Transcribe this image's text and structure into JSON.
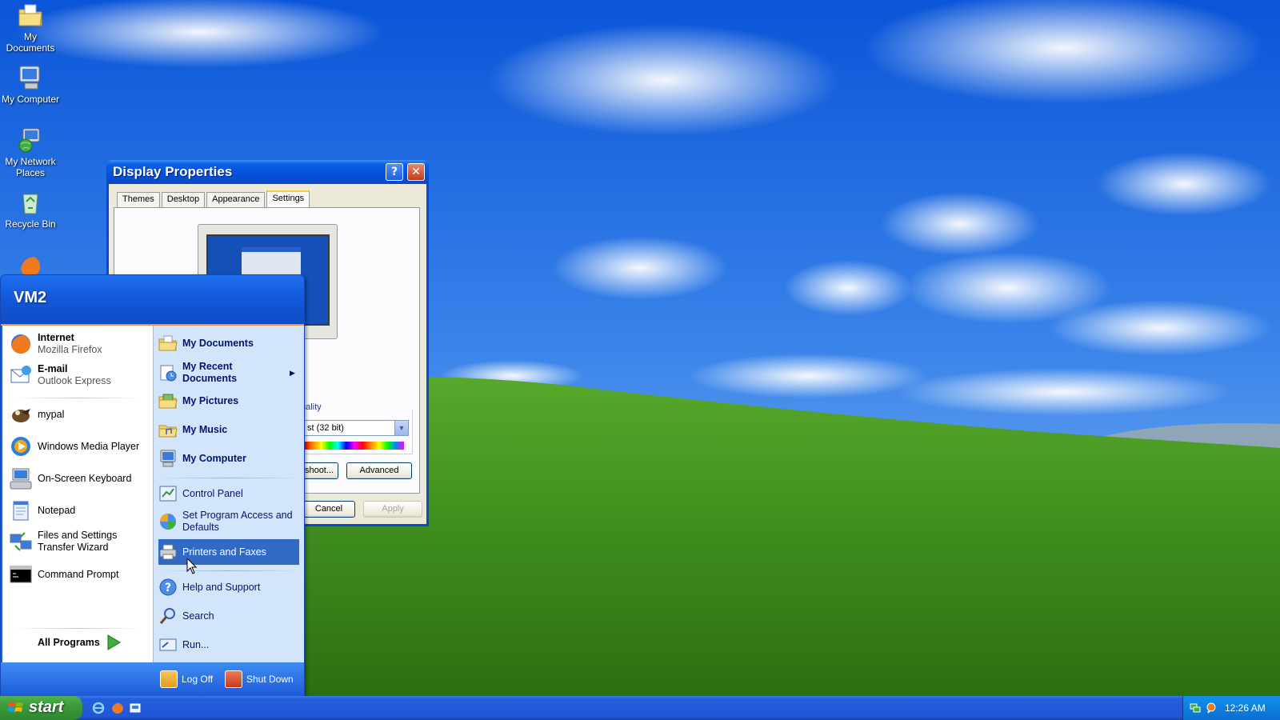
{
  "desktop": {
    "icons": [
      {
        "label": "My Documents"
      },
      {
        "label": "My Computer"
      },
      {
        "label": "My Network Places"
      },
      {
        "label": "Recycle Bin"
      }
    ]
  },
  "display_properties": {
    "title": "Display Properties",
    "help_glyph": "?",
    "close_glyph": "✕",
    "tabs": [
      "Themes",
      "Desktop",
      "Appearance",
      "Settings"
    ],
    "quality_label": "uality",
    "color_value": "st (32 bit)",
    "troubleshoot_label": "shoot...",
    "advanced_label": "Advanced",
    "cancel_label": "Cancel",
    "apply_label": "Apply"
  },
  "start_menu": {
    "user": "VM2",
    "pinned": [
      {
        "title": "Internet",
        "subtitle": "Mozilla Firefox"
      },
      {
        "title": "E-mail",
        "subtitle": "Outlook Express"
      }
    ],
    "recent": [
      {
        "label": "mypal"
      },
      {
        "label": "Windows Media Player"
      },
      {
        "label": "On-Screen Keyboard"
      },
      {
        "label": "Notepad"
      },
      {
        "label": "Files and Settings Transfer Wizard"
      },
      {
        "label": "Command Prompt"
      }
    ],
    "all_programs": "All Programs",
    "places": [
      {
        "label": "My Documents"
      },
      {
        "label": "My Recent Documents"
      },
      {
        "label": "My Pictures"
      },
      {
        "label": "My Music"
      },
      {
        "label": "My Computer"
      }
    ],
    "system": [
      {
        "label": "Control Panel"
      },
      {
        "label": "Set Program Access and Defaults"
      },
      {
        "label": "Printers and Faxes"
      }
    ],
    "tools": [
      {
        "label": "Help and Support"
      },
      {
        "label": "Search"
      },
      {
        "label": "Run..."
      }
    ],
    "log_off": "Log Off",
    "shut_down": "Shut Down",
    "highlighted_item": "Printers and Faxes",
    "colors": {
      "highlight": "#316ac5",
      "header_accent": "#f29436",
      "panel_right": "#d3e5fa"
    }
  },
  "taskbar": {
    "start_label": "start",
    "clock": "12:26 AM"
  }
}
